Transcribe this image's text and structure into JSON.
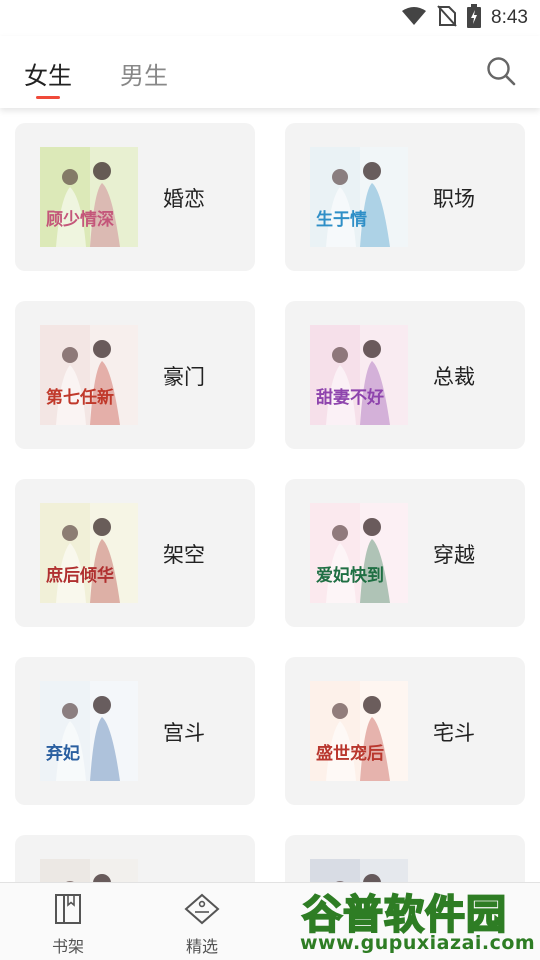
{
  "status_bar": {
    "time": "8:43"
  },
  "tabs": [
    {
      "label": "女生",
      "active": true
    },
    {
      "label": "男生",
      "active": false
    }
  ],
  "categories": [
    {
      "label": "婚恋",
      "cover": {
        "bg": "#dce9b8",
        "accent": "#c4567a",
        "title": "顾少情深不浅"
      }
    },
    {
      "label": "职场",
      "cover": {
        "bg": "#eaf2f5",
        "accent": "#2f8fc7",
        "title": "生于情"
      }
    },
    {
      "label": "豪门",
      "cover": {
        "bg": "#f3e6e4",
        "accent": "#c0392b",
        "title": "第七任新娘"
      }
    },
    {
      "label": "总裁",
      "cover": {
        "bg": "#f6e0ea",
        "accent": "#8e44ad",
        "title": "甜妻不好惹"
      }
    },
    {
      "label": "架空",
      "cover": {
        "bg": "#f1f0d8",
        "accent": "#b03030",
        "title": "庶后倾华"
      }
    },
    {
      "label": "穿越",
      "cover": {
        "bg": "#fbe9ee",
        "accent": "#1f6f43",
        "title": "爱妃快到碗里来"
      }
    },
    {
      "label": "宫斗",
      "cover": {
        "bg": "#eef3f7",
        "accent": "#2a5fa0",
        "title": "弃妃"
      }
    },
    {
      "label": "宅斗",
      "cover": {
        "bg": "#fdf1ea",
        "accent": "#b9372e",
        "title": "盛世宠后"
      }
    },
    {
      "label": "",
      "cover": {
        "bg": "#ece8e4",
        "accent": "#444444",
        "title": ""
      }
    },
    {
      "label": "",
      "cover": {
        "bg": "#d8dce4",
        "accent": "#333344",
        "title": ""
      }
    }
  ],
  "bottom_nav": [
    {
      "label": "书架",
      "icon": "bookshelf-icon"
    },
    {
      "label": "精选",
      "icon": "tag-icon"
    }
  ],
  "watermark": {
    "title": "谷普软件园",
    "url": "www.gupuxiazai.com"
  },
  "colors": {
    "accent": "#f04a3a",
    "card_bg": "#f3f3f3",
    "watermark_green": "#2e7d24"
  }
}
